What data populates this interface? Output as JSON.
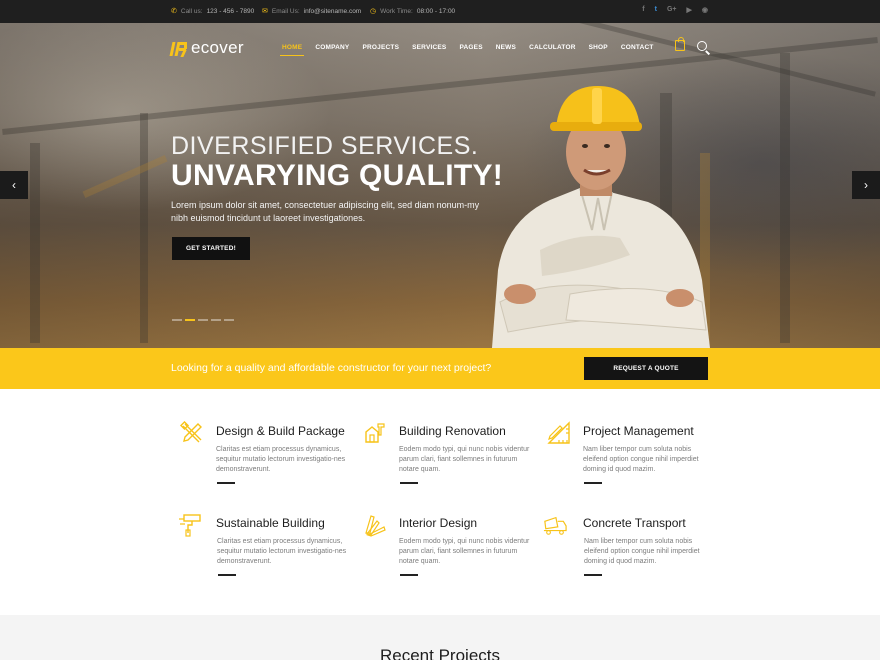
{
  "topbar": {
    "phone_label": "Call us:",
    "phone": "123 - 456 - 7890",
    "email_label": "Email Us:",
    "email": "info@sitename.com",
    "hours_label": "Work Time:",
    "hours": "08:00 - 17:00",
    "socials": [
      "facebook-icon",
      "twitter-icon",
      "google-plus-icon",
      "youtube-icon",
      "rss-icon"
    ],
    "social_glyphs": [
      "f",
      "t",
      "G+",
      "▶",
      "◉"
    ]
  },
  "brand": {
    "logo_text": "ecover",
    "accent": "#f7c31a"
  },
  "nav": {
    "items": [
      "HOME",
      "COMPANY",
      "PROJECTS",
      "SERVICES",
      "PAGES",
      "NEWS",
      "CALCULATOR",
      "SHOP",
      "CONTACT"
    ],
    "active": "HOME"
  },
  "hero": {
    "line1": "DIVERSIFIED SERVICES.",
    "line2": "UNVARYING QUALITY!",
    "text": "Lorem ipsum dolor sit amet, consectetuer adipiscing elit, sed diam nonum-my nibh euismod tincidunt ut laoreet investigationes.",
    "cta": "GET STARTED!",
    "prev": "‹",
    "next": "›",
    "slide_count": 5,
    "active_slide": 2
  },
  "quote": {
    "text": "Looking for a quality and affordable constructor for your next project?",
    "button": "REQUEST A QUOTE",
    "color": "#fbc71a"
  },
  "services": [
    {
      "title": "Design & Build Package",
      "desc": "Claritas est etiam processus dynamicus, sequitur mutatio lectorum investigatio-nes demonstraverunt.",
      "icon": "tools-icon"
    },
    {
      "title": "Building Renovation",
      "desc": "Eodem modo typi, qui nunc nobis videntur parum clari, fiant sollemnes in futurum notare quam.",
      "icon": "renovation-icon"
    },
    {
      "title": "Project Management",
      "desc": "Nam liber tempor cum soluta nobis eleifend option congue nihil imperdiet doming id quod mazim.",
      "icon": "ruler-pencil-icon"
    },
    {
      "title": "Sustainable Building",
      "desc": "Claritas est etiam processus dynamicus, sequitur mutatio lectorum investigatio-nes demonstraverunt.",
      "icon": "roller-icon"
    },
    {
      "title": "Interior Design",
      "desc": "Eodem modo typi, qui nunc nobis videntur parum clari, fiant sollemnes in futurum notare quam.",
      "icon": "color-swatch-icon"
    },
    {
      "title": "Concrete Transport",
      "desc": "Nam liber tempor cum soluta nobis eleifend option congue nihil imperdiet doming id quod mazim.",
      "icon": "concrete-truck-icon"
    }
  ],
  "recent": {
    "title": "Recent Projects"
  }
}
